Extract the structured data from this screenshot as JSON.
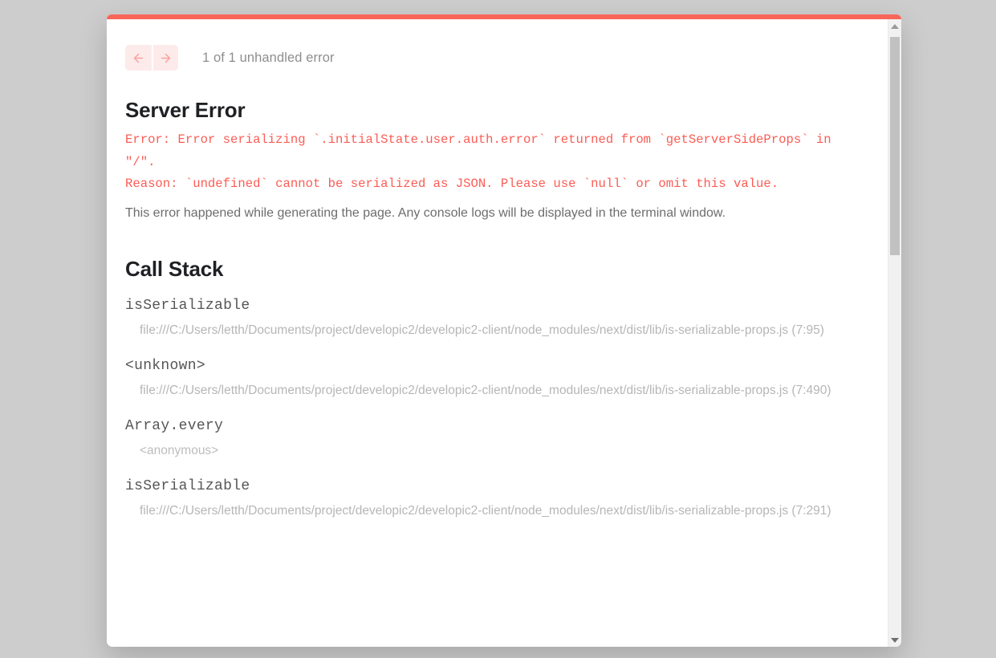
{
  "overlay": {
    "background_color": "#cdcdcd",
    "accent_color": "#f8665a"
  },
  "nav": {
    "prev_label": "←",
    "next_label": "→",
    "count_text": "1 of 1 unhandled error"
  },
  "error": {
    "title": "Server Error",
    "message": "Error: Error serializing `.initialState.user.auth.error` returned from `getServerSideProps` in \"/\".\nReason: `undefined` cannot be serialized as JSON. Please use `null` or omit this value.",
    "note": "This error happened while generating the page. Any console logs will be displayed in the terminal window.",
    "message_color": "#fb5c54"
  },
  "call_stack": {
    "title": "Call Stack",
    "frames": [
      {
        "function": "isSerializable",
        "location": "file:///C:/Users/letth/Documents/project/developic2/developic2-client/node_modules/next/dist/lib/is-serializable-props.js (7:95)"
      },
      {
        "function": "<unknown>",
        "location": "file:///C:/Users/letth/Documents/project/developic2/developic2-client/node_modules/next/dist/lib/is-serializable-props.js (7:490)"
      },
      {
        "function": "Array.every",
        "location": "<anonymous>"
      },
      {
        "function": "isSerializable",
        "location": "file:///C:/Users/letth/Documents/project/developic2/developic2-client/node_modules/next/dist/lib/is-serializable-props.js (7:291)"
      }
    ]
  },
  "scrollbar": {
    "up_arrow": "▲",
    "down_arrow": "▼"
  }
}
